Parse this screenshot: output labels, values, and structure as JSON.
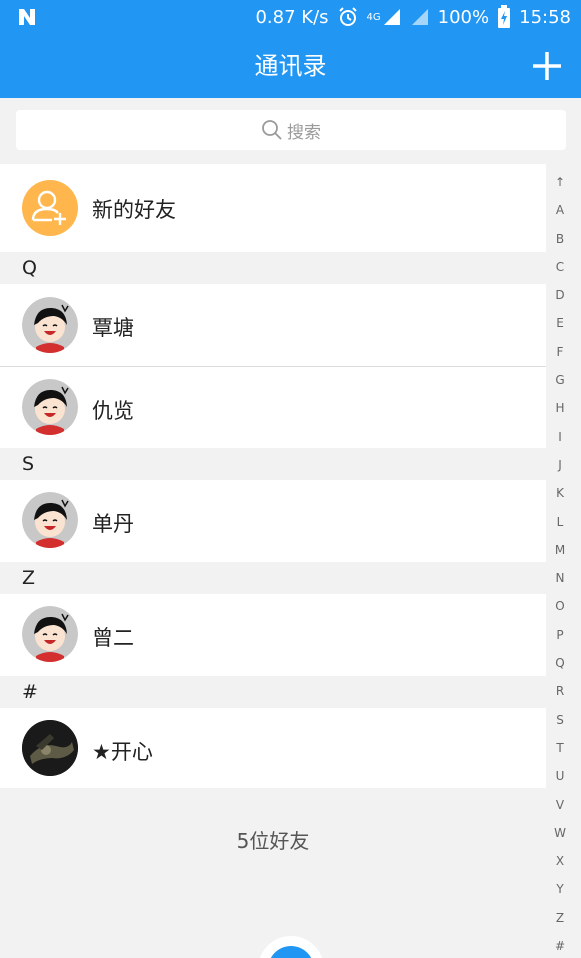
{
  "statusbar": {
    "speed": "0.87 K/s",
    "network": "4G",
    "battery": "100%",
    "time": "15:58"
  },
  "titlebar": {
    "title": "通讯录"
  },
  "search": {
    "placeholder": "搜索"
  },
  "new_friends": {
    "label": "新的好友",
    "icon": "add-user-icon",
    "icon_bg": "#ffb74d"
  },
  "sections": [
    {
      "letter": "Q",
      "contacts": [
        "覃塘",
        "仇览"
      ]
    },
    {
      "letter": "S",
      "contacts": [
        "单丹"
      ]
    },
    {
      "letter": "Z",
      "contacts": [
        "曾二"
      ]
    },
    {
      "letter": "#",
      "contacts": [
        "★开心"
      ]
    }
  ],
  "footer": {
    "count_text": "5位好友"
  },
  "index_bar": [
    "↑",
    "A",
    "B",
    "C",
    "D",
    "E",
    "F",
    "G",
    "H",
    "I",
    "J",
    "K",
    "L",
    "M",
    "N",
    "O",
    "P",
    "Q",
    "R",
    "S",
    "T",
    "U",
    "V",
    "W",
    "X",
    "Y",
    "Z",
    "#"
  ],
  "colors": {
    "primary": "#2196f3",
    "background": "#f2f2f2"
  }
}
